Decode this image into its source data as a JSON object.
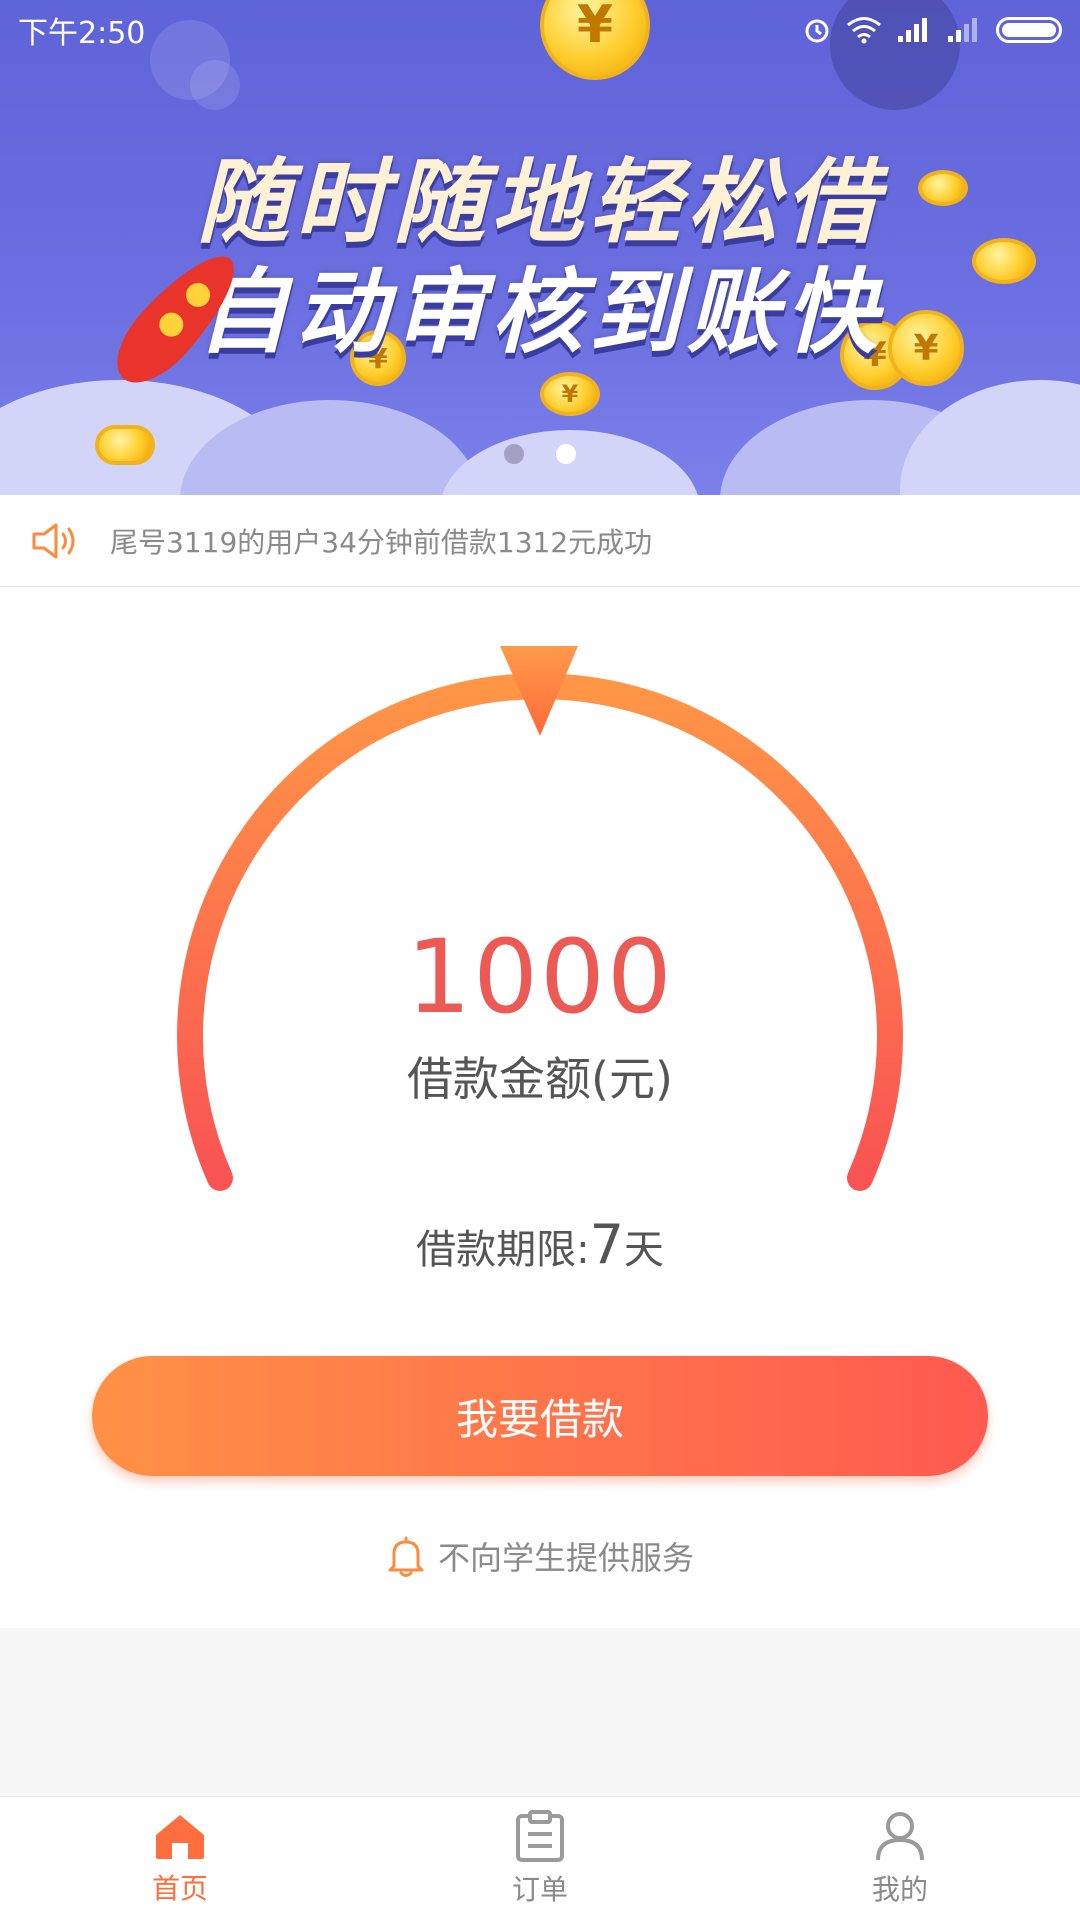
{
  "status_bar": {
    "time": "下午2:50"
  },
  "banner": {
    "line1": "随时随地轻松借",
    "line2": "自动审核到账快",
    "coin_symbol": "¥",
    "slide_count": 2,
    "active_slide": 2
  },
  "notice": {
    "text": "尾号3119的用户34分钟前借款1312元成功"
  },
  "loan": {
    "amount": "1000",
    "amount_label": "借款金额(元)",
    "term_prefix": "借款期限:",
    "term_value": "7",
    "term_unit": "天",
    "button_label": "我要借款",
    "student_notice": "不向学生提供服务"
  },
  "tabs": [
    {
      "label": "首页",
      "icon": "home-icon",
      "active": true
    },
    {
      "label": "订单",
      "icon": "clipboard-icon",
      "active": false
    },
    {
      "label": "我的",
      "icon": "user-icon",
      "active": false
    }
  ],
  "colors": {
    "accent": "#ff6e3e",
    "gradient_start": "#ff9146",
    "gradient_end": "#ff5a50",
    "amount": "#ec5a55",
    "banner_bg": "#6366dc"
  }
}
